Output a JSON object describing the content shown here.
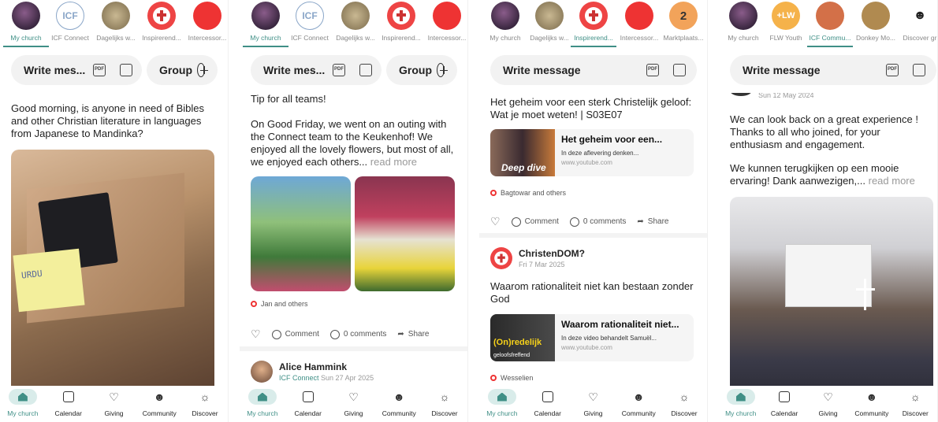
{
  "chips": {
    "my_church": "My church",
    "icf_connect": "ICF Connect",
    "dagelijks": "Dagelijks w...",
    "inspirerend": "Inspirerend...",
    "intercessor": "Intercessor...",
    "marktplaats": "Marktplaats...",
    "flw_youth": "FLW Youth",
    "icf_commu": "ICF Commu...",
    "donkey": "Donkey Mo...",
    "discover_gr": "Discover gr",
    "icf_logo": "ICF",
    "flw_logo": "+LW",
    "badge_2": "2"
  },
  "actions": {
    "write_short": "Write mes...",
    "write_full": "Write message",
    "group": "Group",
    "pdf": "PDF"
  },
  "panel1": {
    "post": "Good morning, is anyone in need of Bibles and other Christian literature in languages from Japanese to Mandinka?",
    "note_text": "URDU"
  },
  "panel2": {
    "line1": "Tip for all teams!",
    "body": "On Good Friday, we went on an outing with the Connect team to the Keukenhof! We enjoyed all the lovely flowers, but most of all, we enjoyed each others...",
    "read_more": "read more",
    "reactors": "Jan and others",
    "comment": "Comment",
    "comments": "0 comments",
    "share": "Share",
    "author": "Alice Hammink",
    "author_group": "ICF Connect",
    "author_date": "Sun 27 Apr 2025"
  },
  "panel3": {
    "post1": "Het geheim voor een sterk Christelijk geloof: Wat je moet weten! | S03E07",
    "card1_title": "Het geheim voor een...",
    "card1_desc": "In deze aflevering denken...",
    "card1_url": "www.youtube.com",
    "card1_thumb": "Deep dive",
    "reactors1": "Bagtowar and others",
    "comment": "Comment",
    "comments": "0 comments",
    "share": "Share",
    "author": "ChristenDOM?",
    "date": "Fri 7 Mar 2025",
    "post2": "Waarom rationaliteit niet kan bestaan zonder God",
    "card2_title": "Waarom rationaliteit niet...",
    "card2_desc": "In deze video behandelt Samuël...",
    "card2_url": "www.youtube.com",
    "card2_thumb1": "(On)redelijk",
    "card2_thumb2": "geloofsfreffend",
    "reactors2": "Wesselien"
  },
  "panel4": {
    "date": "Sun 12 May 2024",
    "p1": "We can look back on a great experience ! Thanks to all who joined, for your enthusiasm and engagement.",
    "p2": "We kunnen terugkijken op een mooie ervaring! Dank aanwezigen,...",
    "read_more": "read more"
  },
  "nav": {
    "my_church": "My church",
    "calendar": "Calendar",
    "giving": "Giving",
    "community": "Community",
    "discover": "Discover"
  },
  "colors": {
    "accent": "#3f8f86",
    "reaction": "#e33333"
  }
}
